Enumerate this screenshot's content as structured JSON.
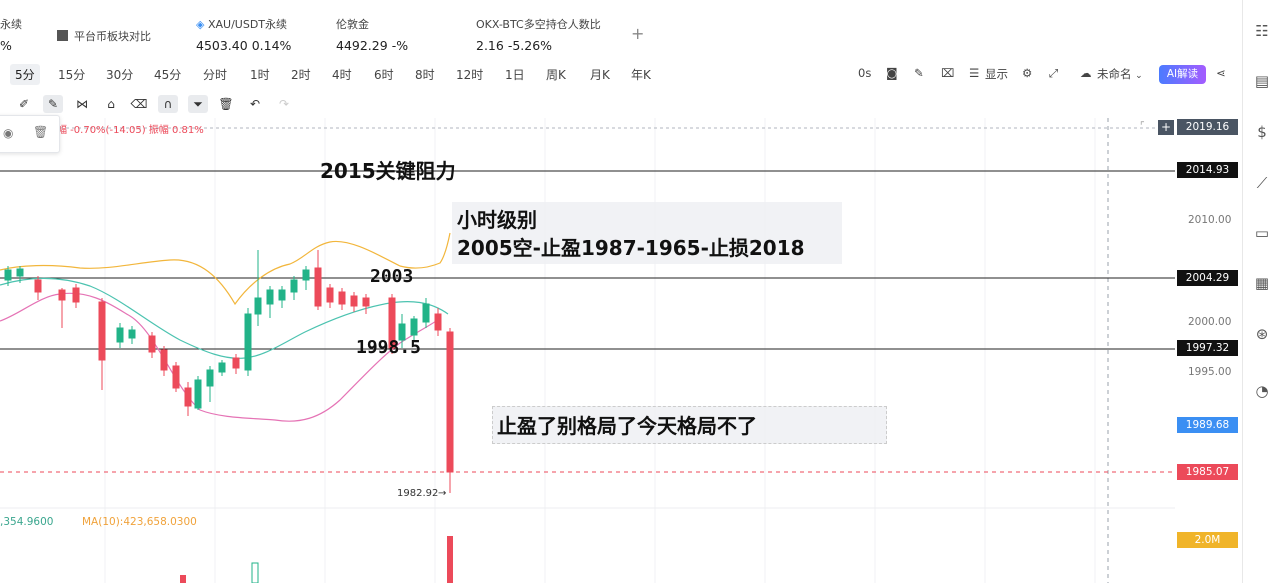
{
  "tickers": [
    {
      "name": "永续",
      "price": "",
      "change": "%"
    },
    {
      "name": "平台币板块对比",
      "price": "",
      "change": ""
    },
    {
      "name": "XAU/USDT永续",
      "price": "4503.40",
      "change": "0.14%"
    },
    {
      "name": "伦敦金",
      "price": "4492.29",
      "change": "-%"
    },
    {
      "name": "OKX-BTC多空持仓人数比",
      "price": "2.16",
      "change": "-5.26%"
    }
  ],
  "add_label": "+",
  "timeframes": [
    "5分",
    "15分",
    "30分",
    "45分",
    "分时",
    "1时",
    "2时",
    "4时",
    "6时",
    "8时",
    "12时",
    "1日",
    "周K",
    "月K",
    "年K"
  ],
  "active_timeframe": "5分",
  "toolbar": {
    "seconds": "0s",
    "display": "显示",
    "unnamed": "未命名",
    "ai_label": "AI解读"
  },
  "legend": {
    "change_text": "幅 -0.70%(-14.05)  振幅 0.81%",
    "volume_text": ",354.9600",
    "ma_text": "MA(10):423,658.0300"
  },
  "price_axis": {
    "ticks": [
      "2010.00",
      "2000.00",
      "1995.00"
    ],
    "tags": [
      {
        "label": "2019.16",
        "color": "#4a5563"
      },
      {
        "label": "2014.93",
        "color": "#111111"
      },
      {
        "label": "2004.29",
        "color": "#111111"
      },
      {
        "label": "1997.32",
        "color": "#111111"
      },
      {
        "label": "1989.68",
        "color": "#3b8ff3"
      },
      {
        "label": "1985.07",
        "color": "#ec4a5a"
      },
      {
        "label": "2.0M",
        "color": "#f0b429"
      }
    ],
    "low_marker": "1982.92"
  },
  "annotations": {
    "resistance": "2015关键阻力",
    "hour_title": "小时级别",
    "plan": "2005空-止盈1987-1965-止损2018",
    "level_2003": "2003",
    "level_1998": "1998.5",
    "takeprofit": "止盈了别格局了今天格局不了"
  },
  "chart_data": {
    "type": "candlestick",
    "hlines": [
      2014.93,
      2004.29,
      1997.32
    ],
    "current_price": 1985.07,
    "low": 1982.92,
    "candles_note": "5-minute candles"
  }
}
